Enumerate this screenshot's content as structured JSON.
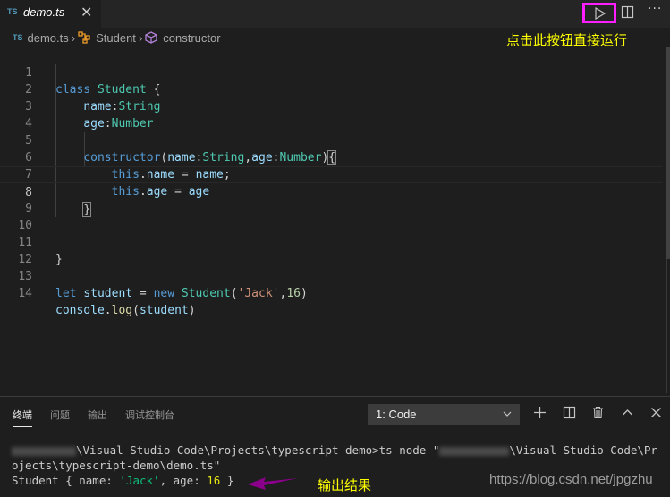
{
  "tab": {
    "lang_badge": "TS",
    "filename": "demo.ts",
    "close_glyph": "✕"
  },
  "actions": {
    "run_icon": "play-icon",
    "split_icon": "split-editor-icon",
    "more_label": "···"
  },
  "breadcrumb": {
    "lang_badge": "TS",
    "items": [
      "demo.ts",
      "Student",
      "constructor"
    ],
    "separator": "›"
  },
  "annotations": {
    "run_hint": "点击此按钮直接运行",
    "output_hint": "输出结果"
  },
  "editor": {
    "current_line": 8,
    "lines": [
      {
        "n": "1"
      },
      {
        "n": "2"
      },
      {
        "n": "3"
      },
      {
        "n": "4"
      },
      {
        "n": "5"
      },
      {
        "n": "6"
      },
      {
        "n": "7"
      },
      {
        "n": "8"
      },
      {
        "n": "9"
      },
      {
        "n": "10"
      },
      {
        "n": "11"
      },
      {
        "n": "12"
      },
      {
        "n": "13"
      },
      {
        "n": "14"
      }
    ],
    "tokens": {
      "class": "class",
      "Student": "Student",
      "lbrace": "{",
      "rbrace": "}",
      "name": "name",
      "age": "age",
      "colon": ":",
      "String": "String",
      "Number": "Number",
      "constructor": "constructor",
      "lparen": "(",
      "rparen": ")",
      "comma": ",",
      "this": "this",
      "dot": ".",
      "eq": " = ",
      "semi": ";",
      "let": "let",
      "student": "student",
      "new": "new",
      "jack": "'Jack'",
      "sixteen": "16",
      "console": "console",
      "log": "log"
    }
  },
  "panel": {
    "tabs": [
      "终端",
      "问题",
      "输出",
      "调试控制台"
    ],
    "active_tab": "终端",
    "terminal_select": "1: Code",
    "icons": [
      "plus-icon",
      "split-terminal-icon",
      "trash-icon",
      "chevron-up-icon",
      "close-icon"
    ]
  },
  "terminal": {
    "line1_a": "\\Visual Studio Code\\Projects\\typescript-demo>ts-node \"",
    "line1_b": "\\Visual Studio Code\\Pr",
    "line2": "ojects\\typescript-demo\\demo.ts\"",
    "out_prefix": "Student { name: ",
    "out_name": "'Jack'",
    "out_mid": ", age: ",
    "out_age": "16",
    "out_suffix": " }"
  },
  "watermark": "https://blog.csdn.net/jpgzhu",
  "colors": {
    "highlight_box": "#ff1eff",
    "annotation": "#ffff00",
    "arrow": "#8b008b"
  }
}
